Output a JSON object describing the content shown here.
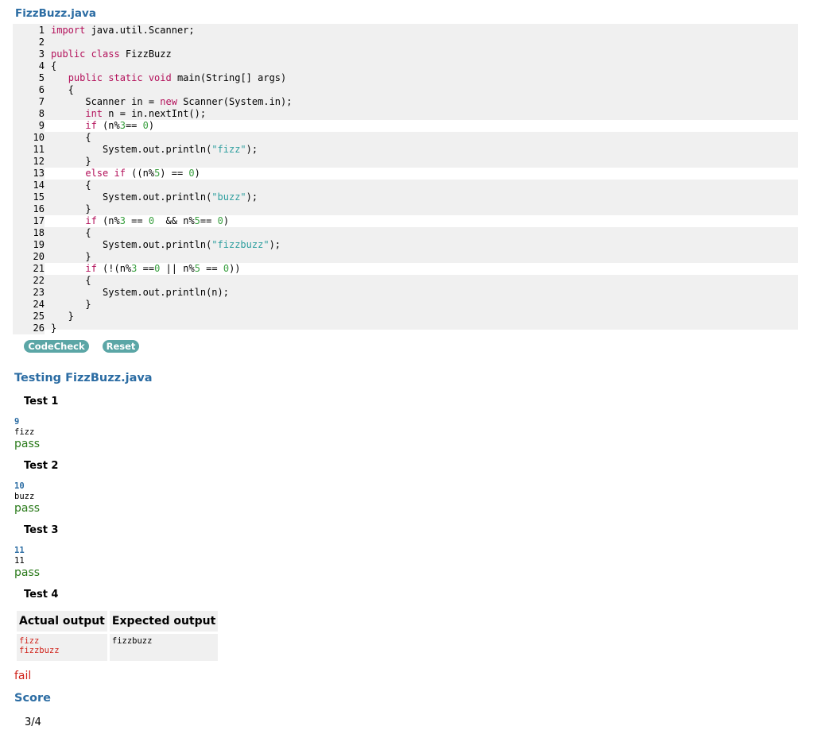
{
  "file_title": "FizzBuzz.java",
  "code_lines": [
    {
      "n": "1",
      "editable": false,
      "tokens": [
        [
          "kw",
          "import"
        ],
        [
          "t",
          " java.util.Scanner;"
        ]
      ]
    },
    {
      "n": "2",
      "editable": false,
      "tokens": []
    },
    {
      "n": "3",
      "editable": false,
      "tokens": [
        [
          "kw",
          "public class"
        ],
        [
          "t",
          " FizzBuzz"
        ]
      ]
    },
    {
      "n": "4",
      "editable": false,
      "tokens": [
        [
          "t",
          "{"
        ]
      ]
    },
    {
      "n": "5",
      "editable": false,
      "tokens": [
        [
          "t",
          "   "
        ],
        [
          "kw",
          "public static void"
        ],
        [
          "t",
          " main("
        ],
        [
          "cls",
          "String"
        ],
        [
          "t",
          "[] args)"
        ]
      ]
    },
    {
      "n": "6",
      "editable": false,
      "tokens": [
        [
          "t",
          "   {"
        ]
      ]
    },
    {
      "n": "7",
      "editable": false,
      "tokens": [
        [
          "t",
          "      Scanner in = "
        ],
        [
          "kw",
          "new"
        ],
        [
          "t",
          " Scanner("
        ],
        [
          "cls",
          "System"
        ],
        [
          "t",
          ".in);"
        ]
      ]
    },
    {
      "n": "8",
      "editable": false,
      "tokens": [
        [
          "t",
          "      "
        ],
        [
          "kw",
          "int"
        ],
        [
          "t",
          " n = in.nextInt();"
        ]
      ]
    },
    {
      "n": "9",
      "editable": true,
      "tokens": [
        [
          "t",
          "      "
        ],
        [
          "kw",
          "if"
        ],
        [
          "t",
          " (n%"
        ],
        [
          "num",
          "3"
        ],
        [
          "t",
          "== "
        ],
        [
          "num",
          "0"
        ],
        [
          "t",
          ")"
        ]
      ]
    },
    {
      "n": "10",
      "editable": false,
      "tokens": [
        [
          "t",
          "      {"
        ]
      ]
    },
    {
      "n": "11",
      "editable": false,
      "tokens": [
        [
          "t",
          "         "
        ],
        [
          "cls",
          "System"
        ],
        [
          "t",
          ".out.println("
        ],
        [
          "str",
          "\"fizz\""
        ],
        [
          "t",
          ");"
        ]
      ]
    },
    {
      "n": "12",
      "editable": false,
      "tokens": [
        [
          "t",
          "      }"
        ]
      ]
    },
    {
      "n": "13",
      "editable": true,
      "tokens": [
        [
          "t",
          "      "
        ],
        [
          "kw",
          "else if"
        ],
        [
          "t",
          " ((n%"
        ],
        [
          "num",
          "5"
        ],
        [
          "t",
          ") == "
        ],
        [
          "num",
          "0"
        ],
        [
          "t",
          ")"
        ]
      ]
    },
    {
      "n": "14",
      "editable": false,
      "tokens": [
        [
          "t",
          "      {"
        ]
      ]
    },
    {
      "n": "15",
      "editable": false,
      "tokens": [
        [
          "t",
          "         "
        ],
        [
          "cls",
          "System"
        ],
        [
          "t",
          ".out.println("
        ],
        [
          "str",
          "\"buzz\""
        ],
        [
          "t",
          ");"
        ]
      ]
    },
    {
      "n": "16",
      "editable": false,
      "tokens": [
        [
          "t",
          "      }"
        ]
      ]
    },
    {
      "n": "17",
      "editable": true,
      "tokens": [
        [
          "t",
          "      "
        ],
        [
          "kw",
          "if"
        ],
        [
          "t",
          " (n%"
        ],
        [
          "num",
          "3"
        ],
        [
          "t",
          " == "
        ],
        [
          "num",
          "0"
        ],
        [
          "t",
          "  && n%"
        ],
        [
          "num",
          "5"
        ],
        [
          "t",
          "== "
        ],
        [
          "num",
          "0"
        ],
        [
          "t",
          ")"
        ]
      ]
    },
    {
      "n": "18",
      "editable": false,
      "tokens": [
        [
          "t",
          "      {"
        ]
      ]
    },
    {
      "n": "19",
      "editable": false,
      "tokens": [
        [
          "t",
          "         "
        ],
        [
          "cls",
          "System"
        ],
        [
          "t",
          ".out.println("
        ],
        [
          "str",
          "\"fizzbuzz\""
        ],
        [
          "t",
          ");"
        ]
      ]
    },
    {
      "n": "20",
      "editable": false,
      "tokens": [
        [
          "t",
          "      }"
        ]
      ]
    },
    {
      "n": "21",
      "editable": true,
      "tokens": [
        [
          "t",
          "      "
        ],
        [
          "kw",
          "if"
        ],
        [
          "t",
          " (!(n%"
        ],
        [
          "num",
          "3"
        ],
        [
          "t",
          " =="
        ],
        [
          "num",
          "0"
        ],
        [
          "t",
          " || n%"
        ],
        [
          "num",
          "5"
        ],
        [
          "t",
          " == "
        ],
        [
          "num",
          "0"
        ],
        [
          "t",
          "))"
        ]
      ]
    },
    {
      "n": "22",
      "editable": false,
      "tokens": [
        [
          "t",
          "      {"
        ]
      ]
    },
    {
      "n": "23",
      "editable": false,
      "tokens": [
        [
          "t",
          "         "
        ],
        [
          "cls",
          "System"
        ],
        [
          "t",
          ".out.println(n);"
        ]
      ]
    },
    {
      "n": "24",
      "editable": false,
      "tokens": [
        [
          "t",
          "      }"
        ]
      ]
    },
    {
      "n": "25",
      "editable": false,
      "tokens": [
        [
          "t",
          "   }"
        ]
      ]
    },
    {
      "n": "26",
      "editable": false,
      "tokens": [
        [
          "t",
          "}"
        ]
      ]
    }
  ],
  "buttons": {
    "codecheck": "CodeCheck",
    "reset": "Reset"
  },
  "testing_title": "Testing FizzBuzz.java",
  "tests": [
    {
      "title": "Test 1",
      "input": "9",
      "output": "fizz",
      "result": "pass"
    },
    {
      "title": "Test 2",
      "input": "10",
      "output": "buzz",
      "result": "pass"
    },
    {
      "title": "Test 3",
      "input": "11",
      "output": "11",
      "result": "pass"
    },
    {
      "title": "Test 4",
      "result": "fail"
    }
  ],
  "comparison": {
    "headers": [
      "Actual output",
      "Expected output"
    ],
    "actual": "fizz\nfizzbuzz",
    "expected": "fizzbuzz"
  },
  "score_title": "Score",
  "score": "3/4",
  "colors": {
    "heading": "#2b6ca3",
    "pass": "#2a7a1a",
    "fail": "#d0221a",
    "button": "#5ba6a6",
    "keyword": "#b3105a",
    "string": "#2f9f9f",
    "number": "#3aa040"
  }
}
